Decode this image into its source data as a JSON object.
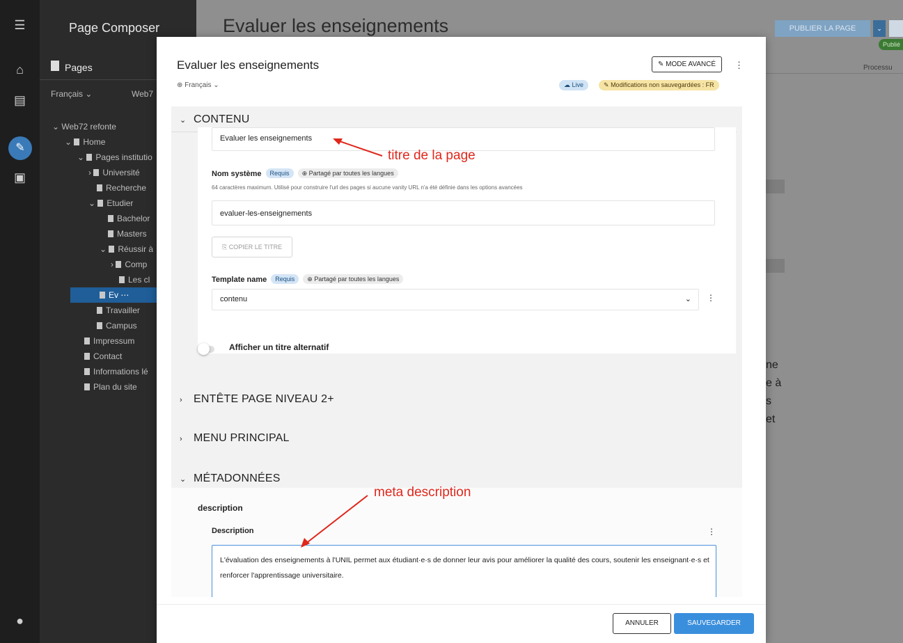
{
  "rail": {
    "icons": [
      "menu-icon",
      "home-icon",
      "clipboard-icon",
      "edit-icon",
      "gallery-icon",
      "user-icon"
    ]
  },
  "tree": {
    "title": "Page Composer",
    "pages_label": "Pages",
    "language": "Français ⌄",
    "site": "Web7",
    "nodes": [
      {
        "label": "Web72 refonte"
      },
      {
        "label": "Home"
      },
      {
        "label": "Pages institutio"
      },
      {
        "label": "Université"
      },
      {
        "label": "Recherche"
      },
      {
        "label": "Etudier"
      },
      {
        "label": "Bachelor"
      },
      {
        "label": "Masters"
      },
      {
        "label": "Réussir à"
      },
      {
        "label": "Comp"
      },
      {
        "label": "Les cl"
      },
      {
        "label": "Ev ⋯"
      },
      {
        "label": "Travailler"
      },
      {
        "label": "Campus"
      },
      {
        "label": "Impressum"
      },
      {
        "label": "Contact"
      },
      {
        "label": "Informations lé"
      },
      {
        "label": "Plan du site"
      }
    ]
  },
  "background": {
    "title": "Evaluer les enseignements",
    "publish_label": "PUBLIER LA PAGE",
    "published_badge": "Publié",
    "process_label": "Processu",
    "fragments": [
      "ne",
      "e à",
      "s",
      "et"
    ]
  },
  "modal": {
    "title": "Evaluer les enseignements",
    "language": "Français ⌄",
    "advanced_mode": "MODE AVANCÉ",
    "badge_live": "Live",
    "badge_unsaved": "Modifications non sauvegardées : FR",
    "sections": {
      "content": "CONTENU",
      "header_level2": "ENTÊTE PAGE NIVEAU 2+",
      "main_menu": "MENU PRINCIPAL",
      "metadata": "MÉTADONNÉES"
    },
    "fields": {
      "title_value": "Evaluer les enseignements",
      "system_name_label": "Nom système",
      "required_chip": "Requis",
      "shared_chip": "Partagé par toutes les langues",
      "system_name_hint": "64 caractères maximum. Utilisé pour construire l'url des pages si aucune vanity URL n'a été définie dans les options avancées",
      "system_name_value": "evaluer-les-enseignements",
      "copy_title": "COPIER LE TITRE",
      "template_label": "Template name",
      "template_value": "contenu",
      "alt_title_toggle": "Afficher un titre alternatif",
      "description_group": "description",
      "description_label": "Description",
      "description_value": "L'évaluation des enseignements à l'UNIL permet aux étudiant·e·s de donner leur avis pour améliorer la qualité des cours, soutenir les enseignant·e·s et renforcer l'apprentissage universitaire."
    },
    "cancel": "ANNULER",
    "save": "SAUVEGARDER"
  },
  "annotations": {
    "title_note": "titre de la page",
    "meta_note": "meta description"
  },
  "colors": {
    "accent": "#3a8fdd",
    "annotation": "#e0271b",
    "selected": "#1f5e99"
  }
}
